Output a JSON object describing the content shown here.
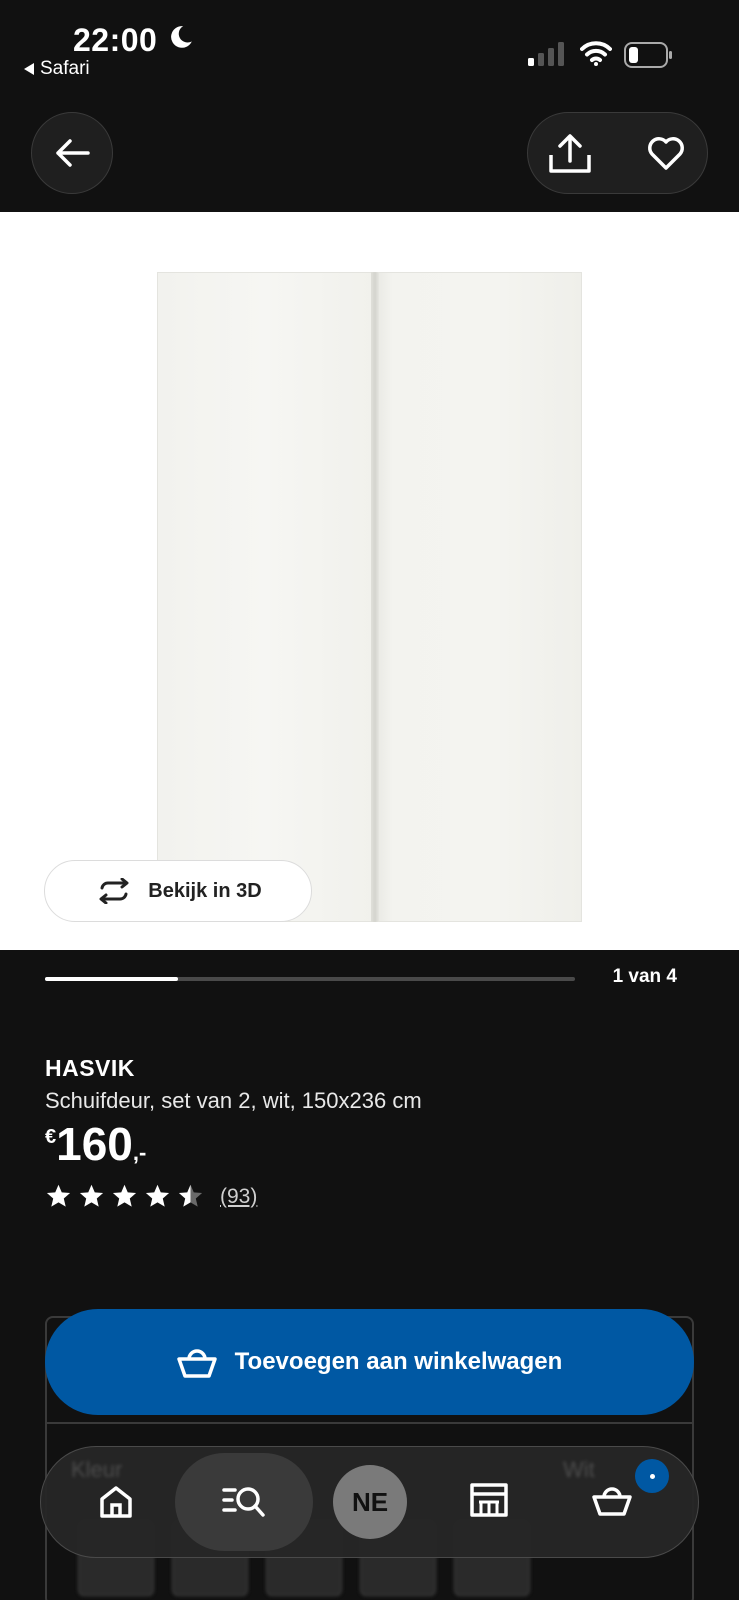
{
  "status_bar": {
    "time": "22:00",
    "back_app": "Safari"
  },
  "image": {
    "view_3d_label": "Bekijk in 3D",
    "carousel_progress": 0.25,
    "page_counter": "1 van 4"
  },
  "product": {
    "name": "HASVIK",
    "description": "Schuifdeur, set van 2, wit, 150x236 cm",
    "currency": "€",
    "price": "160",
    "price_suffix": ",-",
    "rating": 4.5,
    "review_count": "(93)"
  },
  "cart_button": {
    "label": "Toevoegen aan winkelwagen"
  },
  "tab_bar": {
    "profile_initials": "NE",
    "ghost_left": "Kleur",
    "ghost_right": "Wit"
  },
  "colors": {
    "background": "#111111",
    "accent_blue": "#0058a3",
    "white": "#ffffff"
  },
  "icons": [
    "moon-icon",
    "signal-icon",
    "wifi-icon",
    "battery-icon",
    "back-arrow-icon",
    "share-icon",
    "heart-icon",
    "rotate-3d-icon",
    "star-icon",
    "basket-icon",
    "home-icon",
    "search-list-icon",
    "store-icon"
  ]
}
